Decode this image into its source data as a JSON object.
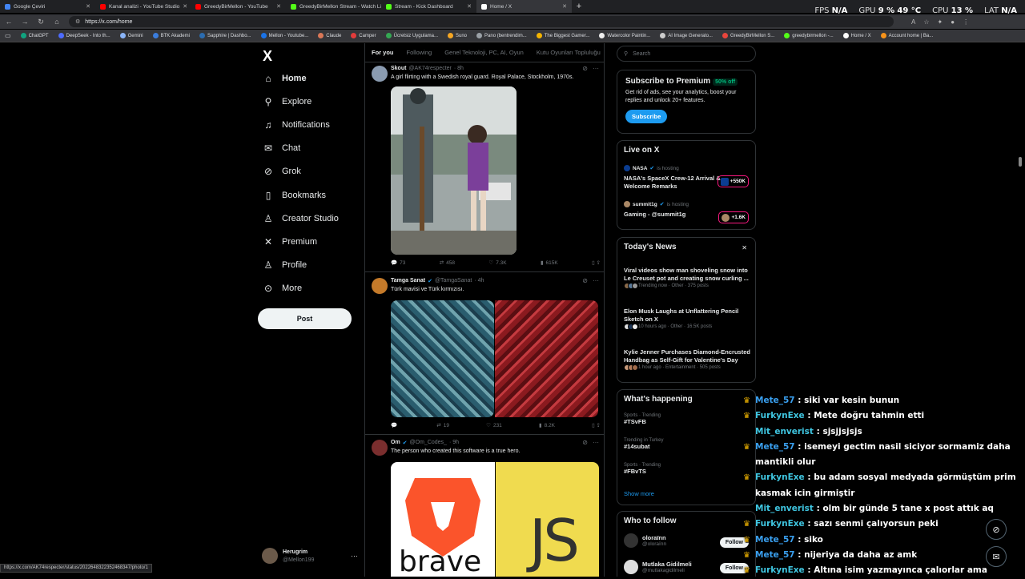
{
  "browser": {
    "tabs": [
      {
        "label": "Google Çeviri",
        "color": "#4285f4"
      },
      {
        "label": "Kanal analizi - YouTube Studio",
        "color": "#ff0000"
      },
      {
        "label": "GreedyBirMellon - YouTube",
        "color": "#ff0000"
      },
      {
        "label": "GreedyBirMellon Stream - Watch Liv",
        "color": "#53fc18"
      },
      {
        "label": "Stream - Kick Dashboard",
        "color": "#53fc18"
      },
      {
        "label": "Home / X",
        "color": "#ffffff"
      }
    ],
    "new_tab": "+",
    "url": "https://x.com/home",
    "hud": {
      "fps_label": "FPS",
      "fps_value": "N/A",
      "gpu_label": "GPU",
      "gpu_value": "9 %",
      "gpu_temp": "49 °C",
      "cpu_label": "CPU",
      "cpu_value": "13 %",
      "lat_label": "LAT",
      "lat_value": "N/A"
    },
    "bookmarks": [
      {
        "label": "ChatGPT",
        "color": "#10a37f"
      },
      {
        "label": "DeepSeek - Into th...",
        "color": "#4d6bfe"
      },
      {
        "label": "Gemini",
        "color": "#8ab4f8"
      },
      {
        "label": "BTK Akademi",
        "color": "#3b7ddd"
      },
      {
        "label": "Sapphire | Dashbo...",
        "color": "#2b6cb0"
      },
      {
        "label": "Mellon - Youtube...",
        "color": "#1a73e8"
      },
      {
        "label": "Claude",
        "color": "#d97757"
      },
      {
        "label": "Camper",
        "color": "#e23b3b"
      },
      {
        "label": "Ücretsiz Uygulama...",
        "color": "#34a853"
      },
      {
        "label": "Suno",
        "color": "#f5a623"
      },
      {
        "label": "Pano (bentrendim...",
        "color": "#9aa0a6"
      },
      {
        "label": "The Biggest Gamer...",
        "color": "#f4b400"
      },
      {
        "label": "Watercolor Paintin...",
        "color": "#eeeeee"
      },
      {
        "label": "AI Image Generato...",
        "color": "#cccccc"
      },
      {
        "label": "GreedyBirMellon S...",
        "color": "#e8453c"
      },
      {
        "label": "greedybirmellon -...",
        "color": "#53fc18"
      },
      {
        "label": "Home / X",
        "color": "#ffffff"
      },
      {
        "label": "Account home | Ba...",
        "color": "#f7931a"
      }
    ],
    "status_url": "https://x.com/AK74respecter/status/2022648322352468347/photo/1"
  },
  "nav": {
    "logo": "X",
    "items": [
      {
        "label": "Home",
        "icon": "home-icon",
        "glyph": "⌂"
      },
      {
        "label": "Explore",
        "icon": "search-icon",
        "glyph": "⚲"
      },
      {
        "label": "Notifications",
        "icon": "bell-icon",
        "glyph": "♫"
      },
      {
        "label": "Chat",
        "icon": "mail-icon",
        "glyph": "✉"
      },
      {
        "label": "Grok",
        "icon": "grok-icon",
        "glyph": "⊘"
      },
      {
        "label": "Bookmarks",
        "icon": "bookmark-icon",
        "glyph": "▯"
      },
      {
        "label": "Creator Studio",
        "icon": "creator-icon",
        "glyph": "♙"
      },
      {
        "label": "Premium",
        "icon": "x-icon",
        "glyph": "✕"
      },
      {
        "label": "Profile",
        "icon": "user-icon",
        "glyph": "♙"
      },
      {
        "label": "More",
        "icon": "more-icon",
        "glyph": "⊙"
      }
    ],
    "post_label": "Post",
    "account": {
      "name": "Herugrim",
      "handle": "@Mellon199",
      "more": "···"
    }
  },
  "feed": {
    "tabs": [
      "For you",
      "Following",
      "Genel Teknoloji, PC, AI, Oyun",
      "Kutu Oyunları Topluluğu"
    ],
    "tweets": [
      {
        "name": "Skout",
        "handle": "@AK74respecter",
        "time": "· 8h",
        "verified": false,
        "text": "A girl flirting with a Swedish royal guard. Royal Palace, Stockholm, 1970s.",
        "replies": "73",
        "reposts": "458",
        "likes": "7.3K",
        "views": "615K"
      },
      {
        "name": "Tamga Sanat",
        "handle": "@TamgaSanat",
        "time": "· 4h",
        "verified": true,
        "text": "Türk mavisi ve Türk kırmızısı.",
        "replies": "",
        "reposts": "19",
        "likes": "231",
        "views": "8.2K"
      },
      {
        "name": "Om",
        "handle": "@Om_Codes_",
        "time": "· 9h",
        "verified": true,
        "text": "The person who created this software is a true hero.",
        "media_left": "brave",
        "media_right": "JS"
      }
    ]
  },
  "right": {
    "search_placeholder": "Search",
    "premium": {
      "title": "Subscribe to Premium",
      "badge": "50% off",
      "text": "Get rid of ads, see your analytics, boost your replies and unlock 20+ features.",
      "button": "Subscribe"
    },
    "live": {
      "title": "Live on X",
      "items": [
        {
          "host": "NASA",
          "hosting": "is hosting",
          "title": "NASA's SpaceX Crew-12 Arrival & Welcome Remarks",
          "count": "+550K"
        },
        {
          "host": "summit1g",
          "hosting": "is hosting",
          "title": "Gaming - @summit1g",
          "count": "+1.6K"
        }
      ]
    },
    "news": {
      "title": "Today's News",
      "close": "✕",
      "items": [
        {
          "title": "Viral videos show man shoveling snow into Le Creuset pot and creating snow curling ...",
          "meta": "Trending now · Other · 375 posts"
        },
        {
          "title": "Elon Musk Laughs at Unflattering Pencil Sketch on X",
          "meta": "10 hours ago · Other · 16.5K posts"
        },
        {
          "title": "Kylie Jenner Purchases Diamond-Encrusted Handbag as Self-Gift for Valentine's Day",
          "meta": "1 hour ago · Entertainment · 505 posts"
        }
      ]
    },
    "happening": {
      "title": "What's happening",
      "items": [
        {
          "cat": "Sports · Trending",
          "tag": "#TSvFB"
        },
        {
          "cat": "Trending in Turkey",
          "tag": "#14subat"
        },
        {
          "cat": "Sports · Trending",
          "tag": "#FBvTS"
        }
      ],
      "more": "Show more"
    },
    "follow": {
      "title": "Who to follow",
      "items": [
        {
          "name": "oloraïnn",
          "handle": "@oloraïnn",
          "button": "Follow"
        },
        {
          "name": "Mutlaka Gidilmeli",
          "handle": "@mutlakagidilmeli",
          "button": "Follow"
        }
      ]
    }
  },
  "chat": [
    {
      "user": "Mete_57",
      "color": "blue",
      "crown": true,
      "msg": ": siki var kesin bunun"
    },
    {
      "user": "FurkynExe",
      "color": "cyan",
      "crown": true,
      "msg": ": Mete doğru tahmin etti"
    },
    {
      "user": "Mit_enverist",
      "color": "cyan",
      "crown": false,
      "msg": ": sjsjjsjsjs"
    },
    {
      "user": "Mete_57",
      "color": "blue",
      "crown": true,
      "msg": ": isemeyi gectim nasil siciyor sormamiz daha mantikli olur"
    },
    {
      "user": "FurkynExe",
      "color": "cyan",
      "crown": true,
      "msg": ": bu adam sosyal medyada görmüştüm prim kasmak icin girmiştir"
    },
    {
      "user": "Mit_enverist",
      "color": "cyan",
      "crown": false,
      "msg": ": olm bir günde 5 tane x post attık aq"
    },
    {
      "user": "FurkynExe",
      "color": "cyan",
      "crown": true,
      "msg": ": sazı senmi çalıyorsun peki"
    },
    {
      "user": "Mete_57",
      "color": "blue",
      "crown": true,
      "msg": ": siko"
    },
    {
      "user": "Mete_57",
      "color": "blue",
      "crown": true,
      "msg": ": nijeriya da daha az amk"
    },
    {
      "user": "FurkynExe",
      "color": "cyan",
      "crown": true,
      "msg": ": Altına isim yazmayınca çalıorlar ama"
    }
  ]
}
